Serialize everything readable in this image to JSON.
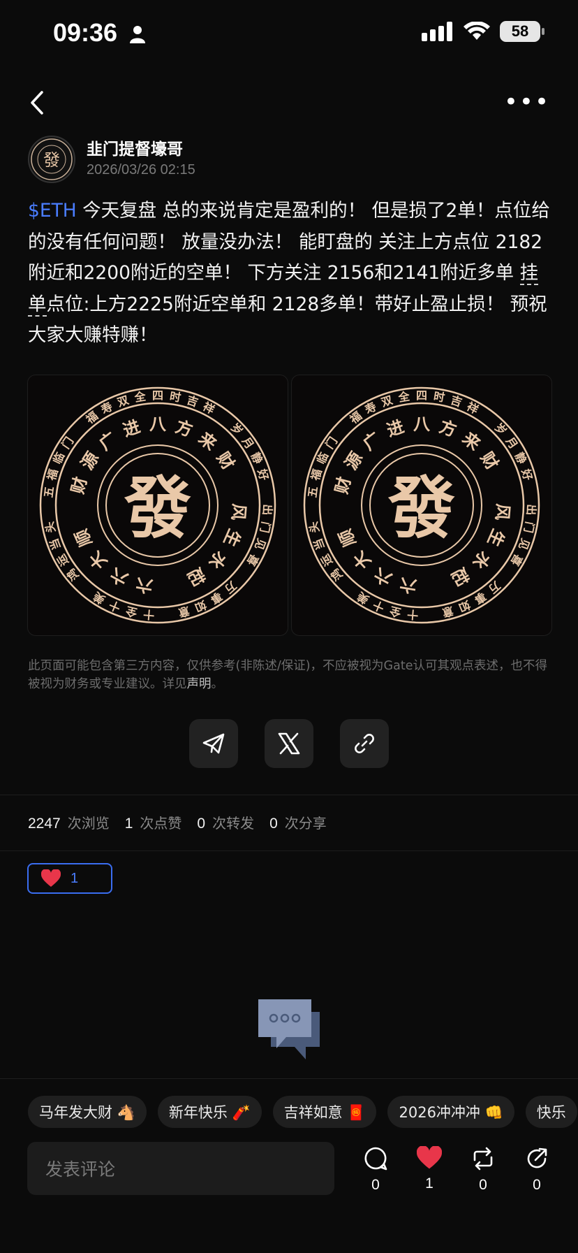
{
  "status_bar": {
    "time": "09:36",
    "battery": "58"
  },
  "author": {
    "name": "韭门提督壕哥",
    "avatar_glyph": "發",
    "timestamp": "2026/03/26 02:15"
  },
  "post": {
    "tag": "$ETH",
    "text_1": " 今天复盘 总的来说肯定是盈利的！ 但是损了2单！点位给的没有任何问题！ 放量没办法！ 能盯盘的 关注上方点位 2182附近和2200附近的空单！ 下方关注 2156和2141附近多单 ",
    "dotted_word": "挂单",
    "text_2": "点位:上方2225附近空单和 2128多单！带好止盈止损！ 预祝大家大赚特赚！"
  },
  "images": {
    "center_char": "發",
    "ring_texts": [
      "八方来财",
      "风生水起",
      "六六大顺",
      "财源广进",
      "四时吉祥",
      "岁月静好",
      "出门见喜",
      "万事如意",
      "十全十美",
      "鸿运当头",
      "五福临门",
      "福寿双全"
    ]
  },
  "disclaimer": {
    "text": "此页面可能包含第三方内容，仅供参考(非陈述/保证)，不应被视为Gate认可其观点表述，也不得被视为财务或专业建议。详见",
    "link": "声明",
    "end": "。"
  },
  "stats": {
    "views": "2247",
    "views_label": "次浏览",
    "likes": "1",
    "likes_label": "次点赞",
    "reposts": "0",
    "reposts_label": "次转发",
    "shares": "0",
    "shares_label": "次分享"
  },
  "like_badge": {
    "count": "1"
  },
  "chips": [
    "马年发大财 🐴",
    "新年快乐 🧨",
    "吉祥如意 🧧",
    "2026冲冲冲 👊",
    "快乐"
  ],
  "comment": {
    "placeholder": "发表评论"
  },
  "actions": {
    "comment": "0",
    "like": "1",
    "repost": "0",
    "share": "0"
  },
  "colors": {
    "accent": "#4a7dff",
    "like": "#e8364a",
    "gold": "#e9c8a8"
  }
}
